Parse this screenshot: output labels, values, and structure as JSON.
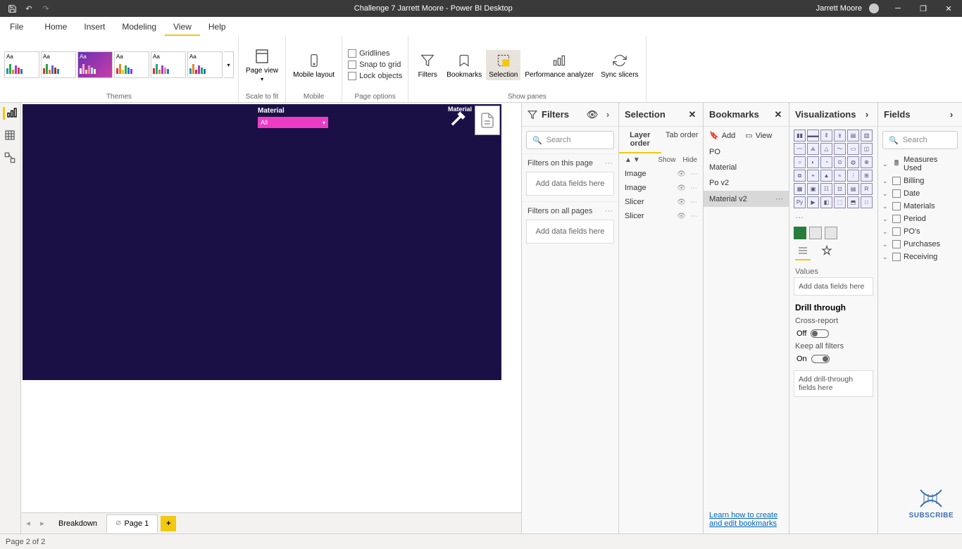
{
  "titlebar": {
    "title": "Challenge 7 Jarrett Moore - Power BI Desktop",
    "user": "Jarrett Moore"
  },
  "menu": {
    "file": "File",
    "items": [
      "Home",
      "Insert",
      "Modeling",
      "View",
      "Help"
    ],
    "active": "View"
  },
  "ribbon": {
    "themes_label": "Themes",
    "scale_label": "Scale to fit",
    "mobile_label": "Mobile",
    "page_options_label": "Page options",
    "show_panes_label": "Show panes",
    "page_view": "Page view",
    "mobile_layout": "Mobile layout",
    "gridlines": "Gridlines",
    "snap": "Snap to grid",
    "lock": "Lock objects",
    "filters": "Filters",
    "bookmarks": "Bookmarks",
    "selection": "Selection",
    "perf": "Performance analyzer",
    "sync": "Sync slicers"
  },
  "canvas": {
    "material_label": "Material",
    "slicer_value": "All",
    "material_txt": "Material"
  },
  "page_tabs": {
    "tabs": [
      "Breakdown",
      "Page 1"
    ],
    "active": "Page 1"
  },
  "filters": {
    "title": "Filters",
    "search": "Search",
    "on_page": "Filters on this page",
    "on_all": "Filters on all pages",
    "drop": "Add data fields here"
  },
  "selection": {
    "title": "Selection",
    "layer": "Layer order",
    "tab": "Tab order",
    "show": "Show",
    "hide": "Hide",
    "items": [
      "Image",
      "Image",
      "Slicer",
      "Slicer"
    ]
  },
  "bookmarks": {
    "title": "Bookmarks",
    "add": "Add",
    "view": "View",
    "items": [
      "PO",
      "Material",
      "Po v2",
      "Material v2"
    ],
    "selected": "Material v2",
    "link": "Learn how to create and edit bookmarks"
  },
  "viz": {
    "title": "Visualizations",
    "values": "Values",
    "values_drop": "Add data fields here",
    "drill": "Drill through",
    "cross": "Cross-report",
    "off": "Off",
    "keep": "Keep all filters",
    "on": "On",
    "drill_drop": "Add drill-through fields here"
  },
  "fields": {
    "title": "Fields",
    "search": "Search",
    "items": [
      {
        "name": "Measures Used",
        "type": "calc"
      },
      {
        "name": "Billing",
        "type": "table"
      },
      {
        "name": "Date",
        "type": "table"
      },
      {
        "name": "Materials",
        "type": "table"
      },
      {
        "name": "Period",
        "type": "table"
      },
      {
        "name": "PO's",
        "type": "table"
      },
      {
        "name": "Purchases",
        "type": "table"
      },
      {
        "name": "Receiving",
        "type": "table"
      }
    ]
  },
  "statusbar": {
    "text": "Page 2 of 2"
  },
  "subscribe": "SUBSCRIBE"
}
